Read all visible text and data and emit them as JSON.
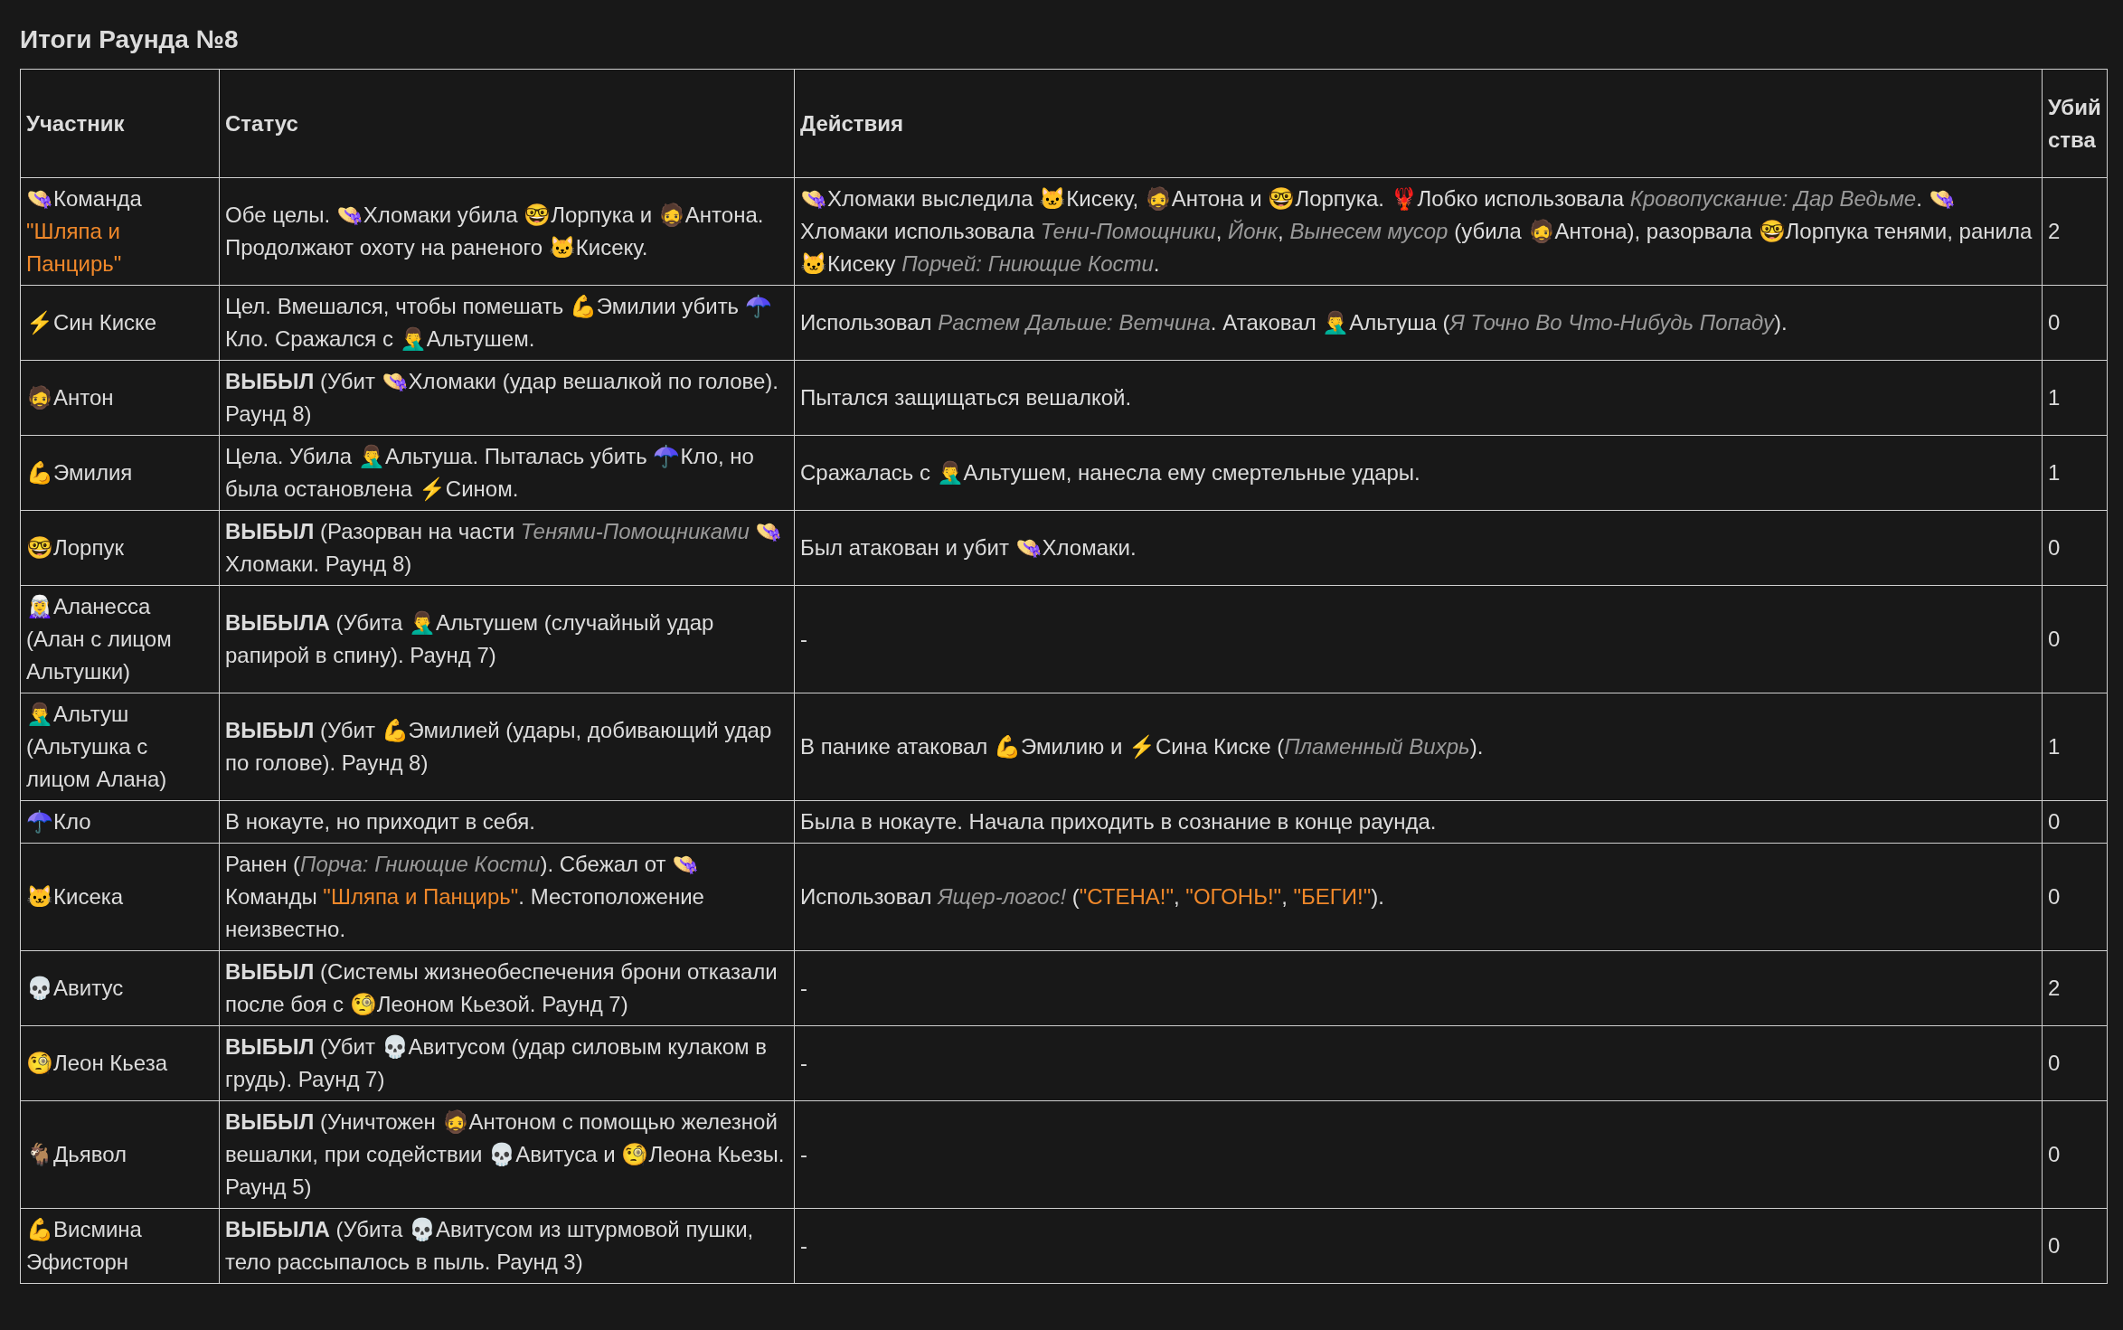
{
  "title": "Итоги Раунда №8",
  "columns": [
    "Участник",
    "Статус",
    "Действия",
    "Убийства"
  ],
  "rows": [
    {
      "participant": [
        {
          "kind": "plain",
          "text": "👒Команда "
        },
        {
          "kind": "accent",
          "text": "\"Шляпа и Панцирь\""
        }
      ],
      "status": [
        {
          "kind": "plain",
          "text": "Обе целы. 👒Хломаки убила 🤓Лорпука и 🧔Антона. Продолжают охоту на раненого 🐱Кисеку."
        }
      ],
      "actions": [
        {
          "kind": "plain",
          "text": "👒Хломаки выследила 🐱Кисеку, 🧔Антона и 🤓Лорпука. 🦞Лобко использовала "
        },
        {
          "kind": "italic",
          "text": "Кровопускание: Дар Ведьме"
        },
        {
          "kind": "plain",
          "text": ". 👒Хломаки использовала "
        },
        {
          "kind": "italic",
          "text": "Тени-Помощники"
        },
        {
          "kind": "plain",
          "text": ", "
        },
        {
          "kind": "italic",
          "text": "Йонк"
        },
        {
          "kind": "plain",
          "text": ", "
        },
        {
          "kind": "italic",
          "text": "Вынесем мусор"
        },
        {
          "kind": "plain",
          "text": " (убила 🧔Антона), разорвала 🤓Лорпука тенями, ранила 🐱Кисеку "
        },
        {
          "kind": "italic",
          "text": "Порчей: Гниющие Кости"
        },
        {
          "kind": "plain",
          "text": "."
        }
      ],
      "kills": "2"
    },
    {
      "participant": [
        {
          "kind": "plain",
          "text": "⚡Син Киске"
        }
      ],
      "status": [
        {
          "kind": "plain",
          "text": "Цел. Вмешался, чтобы помешать 💪Эмилии убить ☂️Кло. Сражался с 🤦‍♂️Альтушем."
        }
      ],
      "actions": [
        {
          "kind": "plain",
          "text": "Использовал "
        },
        {
          "kind": "italic",
          "text": "Растем Дальше: Ветчина"
        },
        {
          "kind": "plain",
          "text": ". Атаковал 🤦‍♂️Альтуша ("
        },
        {
          "kind": "italic",
          "text": "Я Точно Во Что-Нибудь Попаду"
        },
        {
          "kind": "plain",
          "text": ")."
        }
      ],
      "kills": "0"
    },
    {
      "participant": [
        {
          "kind": "plain",
          "text": "🧔Антон"
        }
      ],
      "status": [
        {
          "kind": "bold",
          "text": "ВЫБЫЛ"
        },
        {
          "kind": "plain",
          "text": " (Убит 👒Хломаки (удар вешалкой по голове). Раунд 8)"
        }
      ],
      "actions": [
        {
          "kind": "plain",
          "text": "Пытался защищаться вешалкой."
        }
      ],
      "kills": "1"
    },
    {
      "participant": [
        {
          "kind": "plain",
          "text": "💪Эмилия"
        }
      ],
      "status": [
        {
          "kind": "plain",
          "text": "Цела. Убила 🤦‍♂️Альтуша. Пыталась убить ☂️Кло, но была остановлена ⚡Сином."
        }
      ],
      "actions": [
        {
          "kind": "plain",
          "text": "Сражалась с 🤦‍♂️Альтушем, нанесла ему смертельные удары."
        }
      ],
      "kills": "1"
    },
    {
      "participant": [
        {
          "kind": "plain",
          "text": "🤓Лорпук"
        }
      ],
      "status": [
        {
          "kind": "bold",
          "text": "ВЫБЫЛ"
        },
        {
          "kind": "plain",
          "text": " (Разорван на части "
        },
        {
          "kind": "italic",
          "text": "Тенями-Помощниками"
        },
        {
          "kind": "plain",
          "text": " 👒Хломаки. Раунд 8)"
        }
      ],
      "actions": [
        {
          "kind": "plain",
          "text": "Был атакован и убит 👒Хломаки."
        }
      ],
      "kills": "0"
    },
    {
      "participant": [
        {
          "kind": "plain",
          "text": "🧝‍♀️Аланесса (Алан с лицом Альтушки)"
        }
      ],
      "status": [
        {
          "kind": "bold",
          "text": "ВЫБЫЛА"
        },
        {
          "kind": "plain",
          "text": " (Убита 🤦‍♂️Альтушем (случайный удар рапирой в спину). Раунд 7)"
        }
      ],
      "actions": [
        {
          "kind": "plain",
          "text": "-"
        }
      ],
      "kills": "0"
    },
    {
      "participant": [
        {
          "kind": "plain",
          "text": "🤦‍♂️Альтуш (Альтушка с лицом Алана)"
        }
      ],
      "status": [
        {
          "kind": "bold",
          "text": "ВЫБЫЛ"
        },
        {
          "kind": "plain",
          "text": " (Убит 💪Эмилией (удары, добивающий удар по голове). Раунд 8)"
        }
      ],
      "actions": [
        {
          "kind": "plain",
          "text": "В панике атаковал 💪Эмилию и ⚡Сина Киске ("
        },
        {
          "kind": "italic",
          "text": "Пламенный Вихрь"
        },
        {
          "kind": "plain",
          "text": ")."
        }
      ],
      "kills": "1"
    },
    {
      "participant": [
        {
          "kind": "plain",
          "text": "☂️Кло"
        }
      ],
      "status": [
        {
          "kind": "plain",
          "text": "В нокауте, но приходит в себя."
        }
      ],
      "actions": [
        {
          "kind": "plain",
          "text": "Была в нокауте. Начала приходить в сознание в конце раунда."
        }
      ],
      "kills": "0"
    },
    {
      "participant": [
        {
          "kind": "plain",
          "text": "🐱Кисека"
        }
      ],
      "status": [
        {
          "kind": "plain",
          "text": "Ранен ("
        },
        {
          "kind": "italic",
          "text": "Порча: Гниющие Кости"
        },
        {
          "kind": "plain",
          "text": "). Сбежал от 👒Команды "
        },
        {
          "kind": "accent",
          "text": "\"Шляпа и Панцирь\""
        },
        {
          "kind": "plain",
          "text": ". Местоположение неизвестно."
        }
      ],
      "actions": [
        {
          "kind": "plain",
          "text": "Использовал "
        },
        {
          "kind": "italic",
          "text": "Ящер-логос!"
        },
        {
          "kind": "plain",
          "text": " ("
        },
        {
          "kind": "accent",
          "text": "\"СТЕНА!\""
        },
        {
          "kind": "plain",
          "text": ", "
        },
        {
          "kind": "accent",
          "text": "\"ОГОНЬ!\""
        },
        {
          "kind": "plain",
          "text": ", "
        },
        {
          "kind": "accent",
          "text": "\"БЕГИ!\""
        },
        {
          "kind": "plain",
          "text": ")."
        }
      ],
      "kills": "0"
    },
    {
      "participant": [
        {
          "kind": "plain",
          "text": "💀Авитус"
        }
      ],
      "status": [
        {
          "kind": "bold",
          "text": "ВЫБЫЛ"
        },
        {
          "kind": "plain",
          "text": " (Системы жизнеобеспечения брони отказали после боя с 🧐Леоном Кьезой. Раунд 7)"
        }
      ],
      "actions": [
        {
          "kind": "plain",
          "text": "-"
        }
      ],
      "kills": "2"
    },
    {
      "participant": [
        {
          "kind": "plain",
          "text": "🧐Леон Кьеза"
        }
      ],
      "status": [
        {
          "kind": "bold",
          "text": "ВЫБЫЛ"
        },
        {
          "kind": "plain",
          "text": " (Убит 💀Авитусом (удар силовым кулаком в грудь). Раунд 7)"
        }
      ],
      "actions": [
        {
          "kind": "plain",
          "text": "-"
        }
      ],
      "kills": "0"
    },
    {
      "participant": [
        {
          "kind": "plain",
          "text": "🐐Дьявол"
        }
      ],
      "status": [
        {
          "kind": "bold",
          "text": "ВЫБЫЛ"
        },
        {
          "kind": "plain",
          "text": " (Уничтожен 🧔Антоном с помощью железной вешалки, при содействии 💀Авитуса и 🧐Леона Кьезы. Раунд 5)"
        }
      ],
      "actions": [
        {
          "kind": "plain",
          "text": "-"
        }
      ],
      "kills": "0"
    },
    {
      "participant": [
        {
          "kind": "plain",
          "text": "💪Висмина Эфисторн"
        }
      ],
      "status": [
        {
          "kind": "bold",
          "text": "ВЫБЫЛА"
        },
        {
          "kind": "plain",
          "text": " (Убита 💀Авитусом из штурмовой пушки, тело рассыпалось в пыль. Раунд 3)"
        }
      ],
      "actions": [
        {
          "kind": "plain",
          "text": "-"
        }
      ],
      "kills": "0"
    }
  ]
}
